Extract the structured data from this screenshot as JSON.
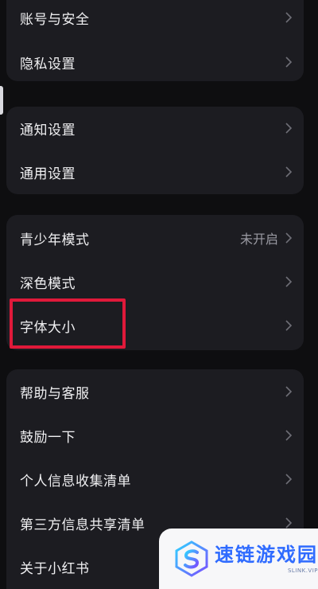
{
  "groups": [
    {
      "items": [
        {
          "label": "账号与安全"
        },
        {
          "label": "隐私设置"
        }
      ]
    },
    {
      "items": [
        {
          "label": "通知设置"
        },
        {
          "label": "通用设置"
        }
      ]
    },
    {
      "items": [
        {
          "label": "青少年模式",
          "value": "未开启"
        },
        {
          "label": "深色模式"
        },
        {
          "label": "字体大小",
          "highlighted": true
        }
      ]
    },
    {
      "items": [
        {
          "label": "帮助与客服"
        },
        {
          "label": "鼓励一下"
        },
        {
          "label": "个人信息收集清单"
        },
        {
          "label": "第三方信息共享清单"
        },
        {
          "label": "关于小红书"
        }
      ]
    }
  ],
  "icons": {
    "row_arrow": "chevron-right-icon",
    "watermark_logo": "s-logo-icon"
  },
  "colors": {
    "background": "#0e0e10",
    "card": "#1c1c21",
    "highlight_border": "#e0193a",
    "watermark_brand": "#2f6bff"
  },
  "watermark": {
    "title": "速链游戏园",
    "subtitle": "SLINK.VIP"
  }
}
